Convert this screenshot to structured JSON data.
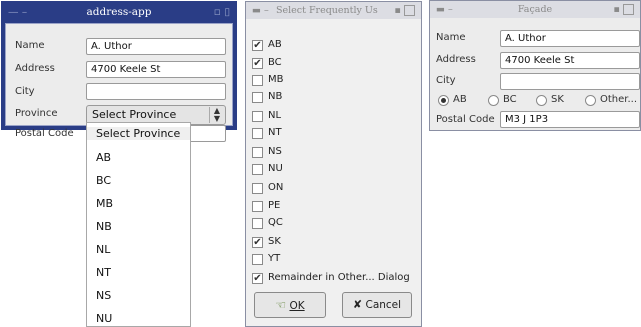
{
  "address_app": {
    "title": "address-app",
    "fields": {
      "name_label": "Name",
      "name_value": "A. Uthor",
      "address_label": "Address",
      "address_value": "4700 Keele St",
      "city_label": "City",
      "city_value": "",
      "province_label": "Province",
      "province_value": "Select Province",
      "postal_label": "Postal Code",
      "postal_value": ""
    },
    "dropdown_options": [
      "Select Province",
      "AB",
      "BC",
      "MB",
      "NB",
      "NL",
      "NT",
      "NS",
      "NU"
    ]
  },
  "frequent_dialog": {
    "title": "Select Frequently Us",
    "items": [
      {
        "label": "AB",
        "checked": true
      },
      {
        "label": "BC",
        "checked": true
      },
      {
        "label": "MB",
        "checked": false
      },
      {
        "label": "NB",
        "checked": false
      },
      {
        "label": "NL",
        "checked": false
      },
      {
        "label": "NT",
        "checked": false
      },
      {
        "label": "NS",
        "checked": false
      },
      {
        "label": "NU",
        "checked": false
      },
      {
        "label": "ON",
        "checked": false
      },
      {
        "label": "PE",
        "checked": false
      },
      {
        "label": "QC",
        "checked": false
      },
      {
        "label": "SK",
        "checked": true
      },
      {
        "label": "YT",
        "checked": false
      },
      {
        "label": "Remainder in Other... Dialog",
        "checked": true
      }
    ],
    "ok_label": "OK",
    "cancel_label": "Cancel"
  },
  "facade": {
    "title": "Façade",
    "name_label": "Name",
    "name_value": "A. Uthor",
    "address_label": "Address",
    "address_value": "4700 Keele St",
    "city_label": "City",
    "city_value": "",
    "radios": [
      {
        "label": "AB",
        "selected": true
      },
      {
        "label": "BC",
        "selected": false
      },
      {
        "label": "SK",
        "selected": false
      },
      {
        "label": "Other...",
        "selected": false
      }
    ],
    "postal_label": "Postal Code",
    "postal_value": "M3 J 1P3"
  },
  "colors": {
    "titlebar_active": "#2a3d86",
    "window_bg": "#ececec"
  }
}
